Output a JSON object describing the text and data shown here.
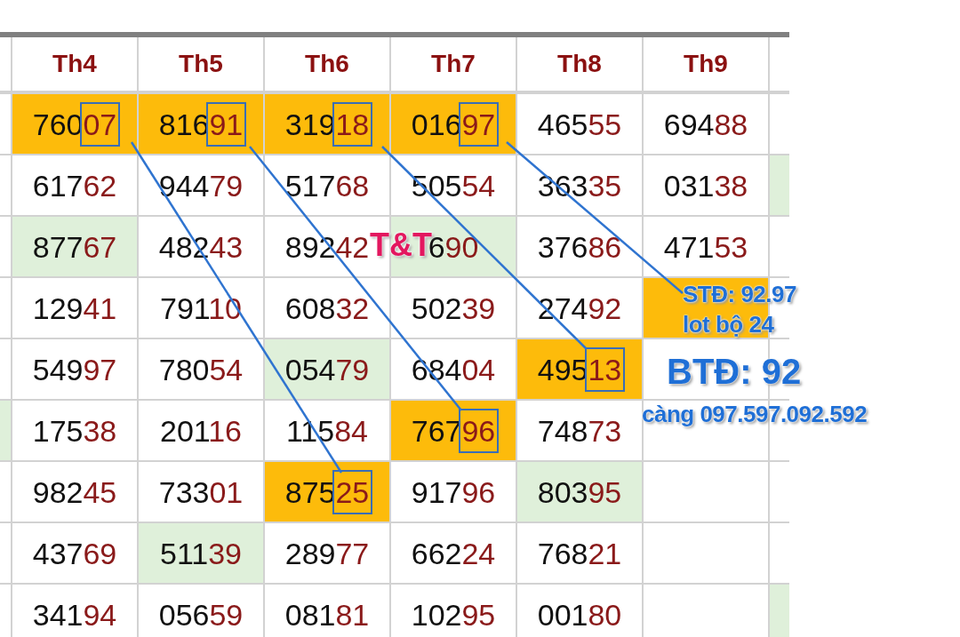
{
  "columns": [
    "Th4",
    "Th5",
    "Th6",
    "Th7",
    "Th8",
    "Th9"
  ],
  "rows": [
    {
      "cells": [
        {
          "text": "76007",
          "color": "#fdbb0b",
          "boxed": true
        },
        {
          "text": "81691",
          "color": "#fdbb0b",
          "boxed": true
        },
        {
          "text": "31918",
          "color": "#fdbb0b",
          "boxed": true
        },
        {
          "text": "01697",
          "color": "#fdbb0b",
          "boxed": true
        },
        {
          "text": "46555",
          "boxed": false
        },
        {
          "text": "69488",
          "boxed": false
        }
      ]
    },
    {
      "right_edge": {
        "color": "#dff0da"
      },
      "cells": [
        {
          "text": "61762",
          "boxed": false
        },
        {
          "text": "94479",
          "boxed": false
        },
        {
          "text": "51768",
          "boxed": false
        },
        {
          "text": "50554",
          "boxed": false
        },
        {
          "text": "36335",
          "boxed": false
        },
        {
          "text": "03138",
          "boxed": false
        }
      ]
    },
    {
      "cells": [
        {
          "text": "87767",
          "color": "#dff0da",
          "boxed": false
        },
        {
          "text": "48243",
          "boxed": false
        },
        {
          "text": "89242",
          "boxed": false
        },
        {
          "text": "690",
          "color": "#dff0da",
          "boxed": false
        },
        {
          "text": "37686",
          "boxed": false
        },
        {
          "text": "47153",
          "boxed": false
        }
      ]
    },
    {
      "cells": [
        {
          "text": "12941",
          "boxed": false
        },
        {
          "text": "79110",
          "boxed": false
        },
        {
          "text": "60832",
          "boxed": false
        },
        {
          "text": "50239",
          "boxed": false
        },
        {
          "text": "27492",
          "boxed": false
        },
        {
          "color": "#fdbb0b"
        }
      ]
    },
    {
      "cells": [
        {
          "text": "54997",
          "boxed": false
        },
        {
          "text": "78054",
          "boxed": false
        },
        {
          "text": "05479",
          "color": "#dff0da",
          "boxed": false
        },
        {
          "text": "68404",
          "boxed": false
        },
        {
          "text": "49513",
          "color": "#fdbb0b",
          "boxed": true
        },
        {}
      ]
    },
    {
      "left_edge": {
        "color": "#dff0da"
      },
      "cells": [
        {
          "text": "17538",
          "boxed": false
        },
        {
          "text": "20116",
          "boxed": false
        },
        {
          "text": "11584",
          "boxed": false
        },
        {
          "text": "76796",
          "color": "#fdbb0b",
          "boxed": true
        },
        {
          "text": "74873",
          "boxed": false
        },
        {}
      ]
    },
    {
      "cells": [
        {
          "text": "98245",
          "boxed": false
        },
        {
          "text": "73301",
          "boxed": false
        },
        {
          "text": "87525",
          "color": "#fdbb0b",
          "boxed": true
        },
        {
          "text": "91796",
          "boxed": false
        },
        {
          "text": "80395",
          "color": "#dff0da",
          "boxed": false
        },
        {}
      ]
    },
    {
      "cells": [
        {
          "text": "43769",
          "boxed": false
        },
        {
          "text": "51139",
          "color": "#dff0da",
          "boxed": false
        },
        {
          "text": "28977",
          "boxed": false
        },
        {
          "text": "66224",
          "boxed": false
        },
        {
          "text": "76821",
          "boxed": false
        },
        {}
      ]
    },
    {
      "right_edge": {
        "color": "#dff0da"
      },
      "cells": [
        {
          "text": "34194",
          "boxed": false
        },
        {
          "text": "05659",
          "boxed": false
        },
        {
          "text": "08181",
          "boxed": false
        },
        {
          "text": "10295",
          "boxed": false
        },
        {
          "text": "00180",
          "boxed": false
        },
        {}
      ]
    }
  ],
  "annotations": [
    {
      "text": "T&T",
      "kind": "stamp"
    },
    {
      "text": "STĐ: 92.97",
      "kind": "note"
    },
    {
      "text": "lot bộ 24",
      "kind": "note"
    },
    {
      "text": "BTĐ: 92",
      "kind": "headline"
    },
    {
      "text": "càng 097.597.092.592",
      "kind": "note"
    }
  ]
}
